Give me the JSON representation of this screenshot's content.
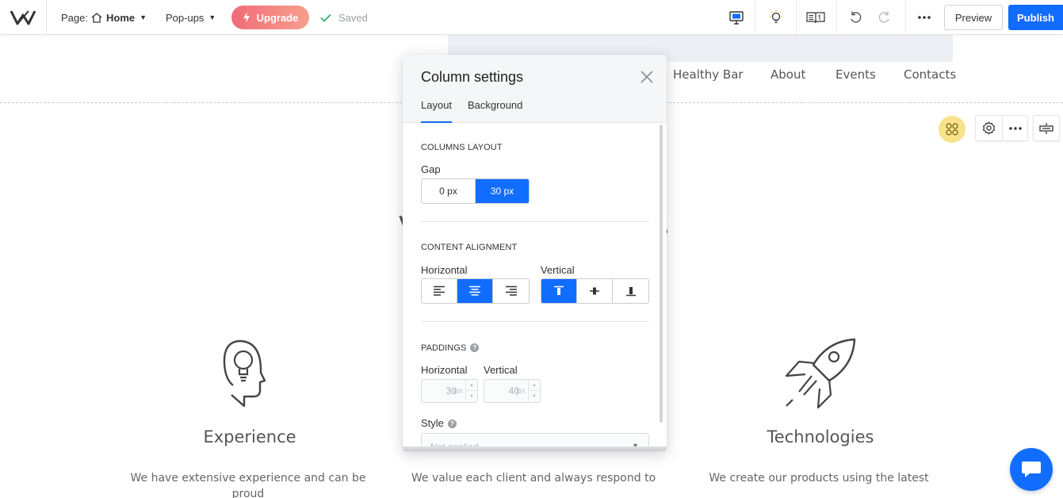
{
  "toolbar": {
    "page_prefix": "Page:",
    "page_name": "Home",
    "popups_label": "Pop-ups",
    "upgrade_label": "Upgrade",
    "saved_label": "Saved",
    "preview_label": "Preview",
    "publish_label": "Publish"
  },
  "site": {
    "nav": [
      "Healthy Bar",
      "About",
      "Events",
      "Contacts"
    ],
    "heading_fragments": [
      "V",
      "s"
    ],
    "features": [
      {
        "title": "Experience",
        "text": "We have extensive experience and can be proud"
      },
      {
        "title": "",
        "text": "We value each client and always respond to"
      },
      {
        "title": "Technologies",
        "text": "We create our products using the latest"
      }
    ]
  },
  "panel": {
    "title": "Column settings",
    "tabs": [
      "Layout",
      "Background"
    ],
    "columns_layout_label": "COLUMNS LAYOUT",
    "gap_label": "Gap",
    "gap_options": [
      "0 px",
      "30 px"
    ],
    "gap_selected": "30 px",
    "content_alignment_label": "CONTENT ALIGNMENT",
    "horizontal_label": "Horizontal",
    "vertical_label": "Vertical",
    "horizontal_selected": "center",
    "vertical_selected": "top",
    "paddings_label": "PADDINGS",
    "padding_horizontal_label": "Horizontal",
    "padding_vertical_label": "Vertical",
    "padding_horizontal_value": "30",
    "padding_vertical_value": "40",
    "padding_unit": "px",
    "style_label": "Style",
    "style_value": "Not applied"
  },
  "colors": {
    "accent": "#116dff",
    "upgrade_start": "#f06b78",
    "upgrade_end": "#f7a08c",
    "column_tool": "#f8e38a"
  }
}
